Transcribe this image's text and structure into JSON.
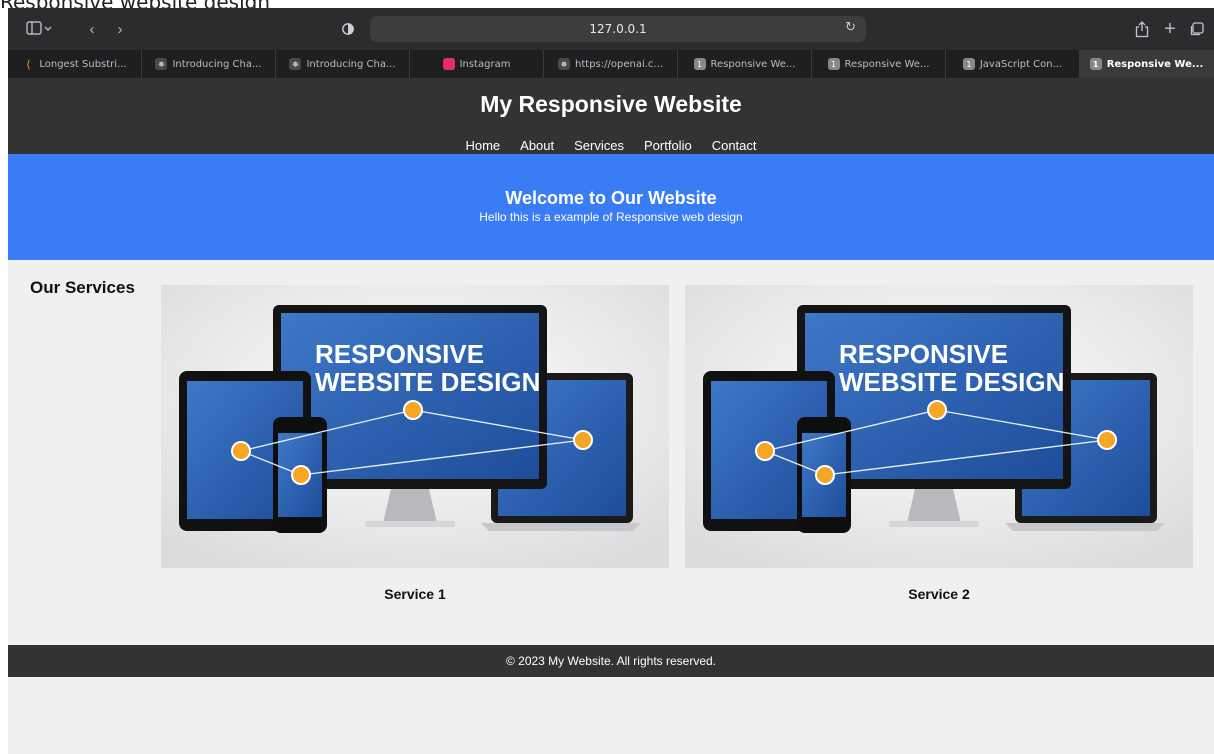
{
  "doc_caption": "Responsive website design",
  "browser": {
    "url": "127.0.0.1",
    "tabs": [
      {
        "label": "Longest Substri...",
        "icon": "leetcode-icon",
        "color": "#f7a11a"
      },
      {
        "label": "Introducing Cha...",
        "icon": "openai-icon",
        "color": "#4a4a4a"
      },
      {
        "label": "Introducing Cha...",
        "icon": "openai-icon",
        "color": "#4a4a4a"
      },
      {
        "label": "Instagram",
        "icon": "instagram-icon",
        "color": "#e1306c"
      },
      {
        "label": "https://openai.c...",
        "icon": "openai-icon",
        "color": "#4a4a4a"
      },
      {
        "label": "Responsive We...",
        "icon": "number-one-icon",
        "color": "#888888"
      },
      {
        "label": "Responsive We...",
        "icon": "number-one-icon",
        "color": "#888888"
      },
      {
        "label": "JavaScript Con...",
        "icon": "number-one-icon",
        "color": "#888888"
      },
      {
        "label": "Responsive We...",
        "icon": "number-one-icon",
        "color": "#888888",
        "active": true
      }
    ]
  },
  "site": {
    "title": "My Responsive Website",
    "nav": [
      "Home",
      "About",
      "Services",
      "Portfolio",
      "Contact"
    ],
    "hero": {
      "heading": "Welcome to Our Website",
      "subtitle": "Hello this is a example of Responsive web design"
    },
    "services_heading": "Our Services",
    "services": [
      {
        "label": "Service 1",
        "image_text_1": "RESPONSIVE",
        "image_text_2": "WEBSITE DESIGN"
      },
      {
        "label": "Service 2",
        "image_text_1": "RESPONSIVE",
        "image_text_2": "WEBSITE DESIGN"
      }
    ],
    "footer": "© 2023 My Website. All rights reserved."
  },
  "colors": {
    "header_bg": "#333333",
    "hero_bg": "#3a7cf6",
    "page_bg": "#f0f0f0",
    "node_orange": "#f5a623"
  }
}
